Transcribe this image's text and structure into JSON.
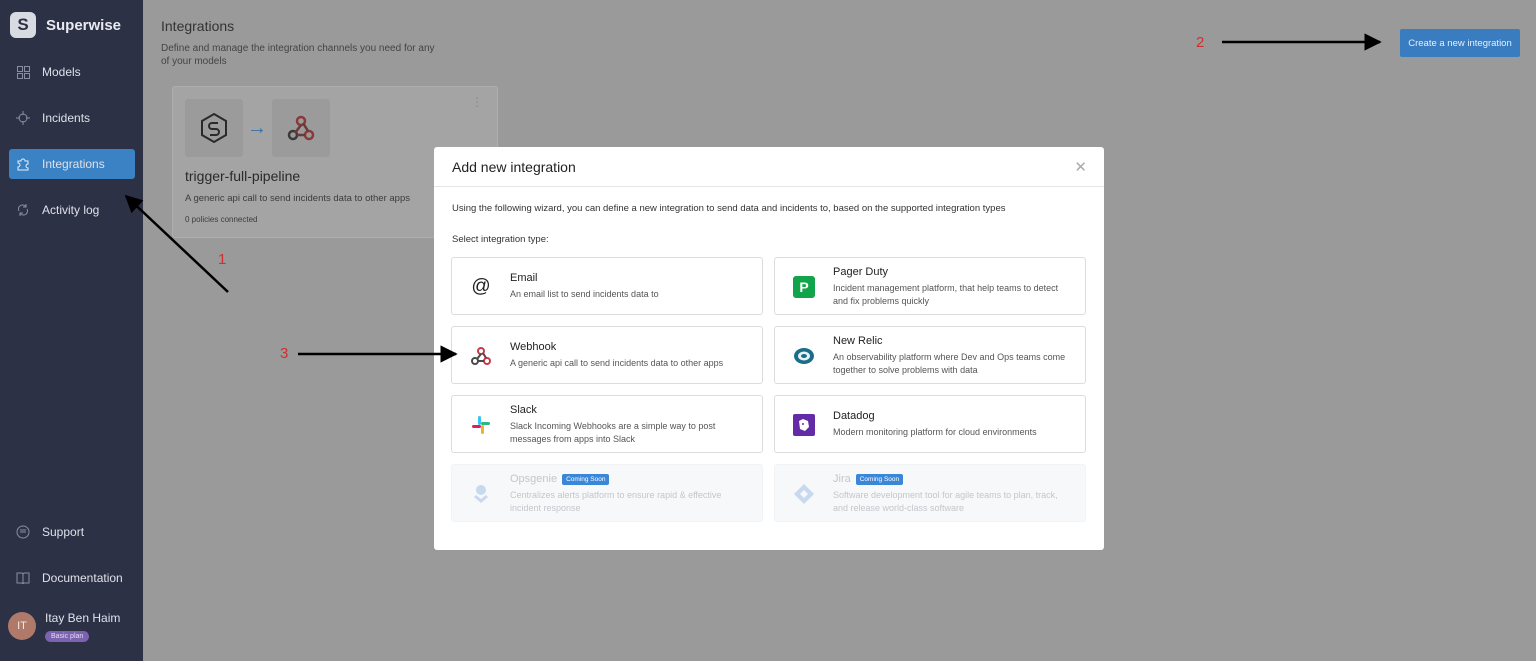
{
  "app": {
    "name": "Superwise"
  },
  "sidebar": {
    "items": [
      {
        "label": "Models",
        "icon": "grid-icon"
      },
      {
        "label": "Incidents",
        "icon": "crosshair-icon"
      },
      {
        "label": "Integrations",
        "icon": "puzzle-icon",
        "active": true
      },
      {
        "label": "Activity log",
        "icon": "sync-icon"
      }
    ],
    "bottom": [
      {
        "label": "Support",
        "icon": "chat-icon"
      },
      {
        "label": "Documentation",
        "icon": "book-icon"
      }
    ],
    "user": {
      "initials": "IT",
      "name": "Itay Ben Haim",
      "plan": "Basic plan"
    }
  },
  "page": {
    "title": "Integrations",
    "subtitle": "Define and manage the integration channels you need for any of your models",
    "create_button": "Create a new integration"
  },
  "card": {
    "title": "trigger-full-pipeline",
    "description": "A generic api call to send incidents data to other apps",
    "meta": "0 policies connected"
  },
  "modal": {
    "title": "Add new integration",
    "intro": "Using the following wizard, you can define a new integration to send data and incidents to, based on the supported integration types",
    "label": "Select integration type:",
    "options": [
      {
        "name": "Email",
        "desc": "An email list to send incidents data to",
        "icon": "at-icon"
      },
      {
        "name": "Pager Duty",
        "desc": "Incident management platform, that help teams to detect and fix problems quickly",
        "icon": "pagerduty-icon"
      },
      {
        "name": "Webhook",
        "desc": "A generic api call to send incidents data to other apps",
        "icon": "webhook-icon"
      },
      {
        "name": "New Relic",
        "desc": "An observability platform where Dev and Ops teams come together to solve problems with data",
        "icon": "newrelic-icon"
      },
      {
        "name": "Slack",
        "desc": "Slack Incoming Webhooks are a simple way to post messages from apps into Slack",
        "icon": "slack-icon"
      },
      {
        "name": "Datadog",
        "desc": "Modern monitoring platform for cloud environments",
        "icon": "datadog-icon"
      },
      {
        "name": "Opsgenie",
        "desc": "Centralizes alerts platform to ensure rapid & effective incident response",
        "icon": "opsgenie-icon",
        "badge": "Coming Soon"
      },
      {
        "name": "Jira",
        "desc": "Software development tool for agile teams to plan, track, and release world-class software",
        "icon": "jira-icon",
        "badge": "Coming Soon"
      }
    ]
  },
  "annotations": [
    "1",
    "2",
    "3"
  ],
  "colors": {
    "sidebar": "#2d3146",
    "accent": "#3b82c4",
    "annotation": "#d32f2f"
  }
}
